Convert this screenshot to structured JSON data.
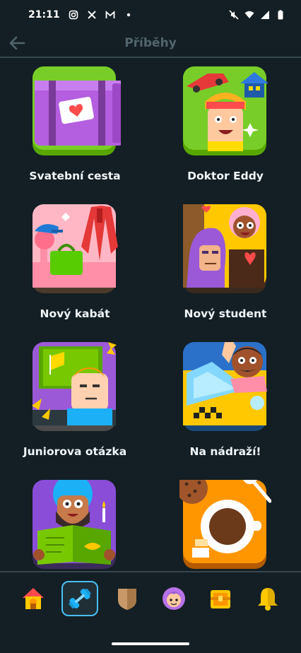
{
  "status_bar": {
    "time": "21:11",
    "left_icons": [
      "instagram-icon",
      "x-icon",
      "gmail-icon",
      "dot-icon"
    ],
    "right_icons": [
      "mute-icon",
      "wifi-icon",
      "signal-icon",
      "battery-icon"
    ]
  },
  "header": {
    "title": "Příběhy",
    "back_icon": "arrow-left-icon"
  },
  "stories": [
    {
      "label": "Svatební cesta"
    },
    {
      "label": "Doktor Eddy"
    },
    {
      "label": "Nový kabát"
    },
    {
      "label": "Nový student"
    },
    {
      "label": "Juniorova otázka"
    },
    {
      "label": "Na nádraží!"
    },
    {
      "label": ""
    },
    {
      "label": ""
    }
  ],
  "bottom_nav": {
    "items": [
      "home-icon",
      "dumbbell-icon",
      "shield-icon",
      "avatar-icon",
      "chest-icon",
      "bell-icon"
    ],
    "active_index": 1
  },
  "colors": {
    "background": "#131f24",
    "divider": "#37464f",
    "title": "#52656d",
    "active_border": "#49c0f8"
  }
}
